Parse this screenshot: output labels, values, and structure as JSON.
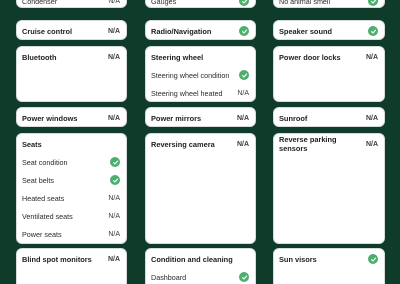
{
  "accent_green": "#4caf6d",
  "background": "#0f3b2b",
  "cards": [
    {
      "id": "c0",
      "rows": [
        {
          "label": "Condenser",
          "status": "N/A",
          "head": false
        }
      ]
    },
    {
      "id": "c1",
      "rows": [
        {
          "label": "Gauges",
          "status": "check",
          "head": false
        }
      ]
    },
    {
      "id": "c2",
      "rows": [
        {
          "label": "No animal smell",
          "status": "check",
          "head": false
        }
      ]
    },
    {
      "id": "c3",
      "rows": [
        {
          "label": "Cruise control",
          "status": "N/A",
          "head": true
        }
      ]
    },
    {
      "id": "c4",
      "rows": [
        {
          "label": "Radio/Navigation",
          "status": "check",
          "head": true
        }
      ]
    },
    {
      "id": "c5",
      "rows": [
        {
          "label": "Speaker sound",
          "status": "check",
          "head": true
        }
      ]
    },
    {
      "id": "c6",
      "rows": [
        {
          "label": "Bluetooth",
          "status": "N/A",
          "head": true
        }
      ]
    },
    {
      "id": "c7",
      "rows": [
        {
          "label": "Steering wheel",
          "status": "",
          "head": true
        },
        {
          "label": "Steering wheel condition",
          "status": "check",
          "head": false
        },
        {
          "label": "Steering wheel heated",
          "status": "N/A",
          "head": false
        }
      ]
    },
    {
      "id": "c8",
      "rows": [
        {
          "label": "Power door locks",
          "status": "N/A",
          "head": true
        }
      ]
    },
    {
      "id": "c9",
      "rows": [
        {
          "label": "Power windows",
          "status": "N/A",
          "head": true
        }
      ]
    },
    {
      "id": "c10",
      "rows": [
        {
          "label": "Power mirrors",
          "status": "N/A",
          "head": true
        }
      ]
    },
    {
      "id": "c11",
      "rows": [
        {
          "label": "Sunroof",
          "status": "N/A",
          "head": true
        }
      ]
    },
    {
      "id": "c12",
      "rows": [
        {
          "label": "Seats",
          "status": "",
          "head": true
        },
        {
          "label": "Seat condition",
          "status": "check",
          "head": false
        },
        {
          "label": "Seat belts",
          "status": "check",
          "head": false
        },
        {
          "label": "Heated seats",
          "status": "N/A",
          "head": false
        },
        {
          "label": "Ventilated seats",
          "status": "N/A",
          "head": false
        },
        {
          "label": "Power seats",
          "status": "N/A",
          "head": false
        }
      ]
    },
    {
      "id": "c13",
      "rows": [
        {
          "label": "Reversing camera",
          "status": "N/A",
          "head": true
        }
      ]
    },
    {
      "id": "c14",
      "rows": [
        {
          "label": "Reverse parking sensors",
          "status": "N/A",
          "head": true
        }
      ]
    },
    {
      "id": "c15",
      "rows": [
        {
          "label": "Blind spot monitors",
          "status": "N/A",
          "head": true
        }
      ]
    },
    {
      "id": "c16",
      "rows": [
        {
          "label": "Condition and cleaning",
          "status": "",
          "head": true
        },
        {
          "label": "Dashboard",
          "status": "check",
          "head": false
        }
      ]
    },
    {
      "id": "c17",
      "rows": [
        {
          "label": "Sun visors",
          "status": "check",
          "head": true
        }
      ]
    }
  ]
}
